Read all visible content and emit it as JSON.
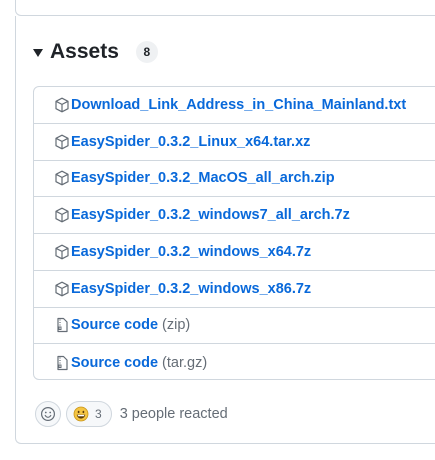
{
  "assets": {
    "title": "Assets",
    "count": "8",
    "items": [
      {
        "name": "Download_Link_Address_in_China_Mainland.txt",
        "icon": "package-icon"
      },
      {
        "name": "EasySpider_0.3.2_Linux_x64.tar.xz",
        "icon": "package-icon"
      },
      {
        "name": "EasySpider_0.3.2_MacOS_all_arch.zip",
        "icon": "package-icon"
      },
      {
        "name": "EasySpider_0.3.2_windows7_all_arch.7z",
        "icon": "package-icon"
      },
      {
        "name": "EasySpider_0.3.2_windows_x64.7z",
        "icon": "package-icon"
      },
      {
        "name": "EasySpider_0.3.2_windows_x86.7z",
        "icon": "package-icon"
      }
    ],
    "source": [
      {
        "label": "Source code",
        "ext": "(zip)",
        "icon": "file-zip-icon"
      },
      {
        "label": "Source code",
        "ext": "(tar.gz)",
        "icon": "file-zip-icon"
      }
    ]
  },
  "reactions": {
    "add_icon": "smiley-icon",
    "emoji": "grinning-face",
    "count": "3",
    "summary": "3 people reacted"
  },
  "colors": {
    "link": "#0969da",
    "muted": "#656d76",
    "border": "#d0d7de",
    "emoji": "#f5c542"
  }
}
